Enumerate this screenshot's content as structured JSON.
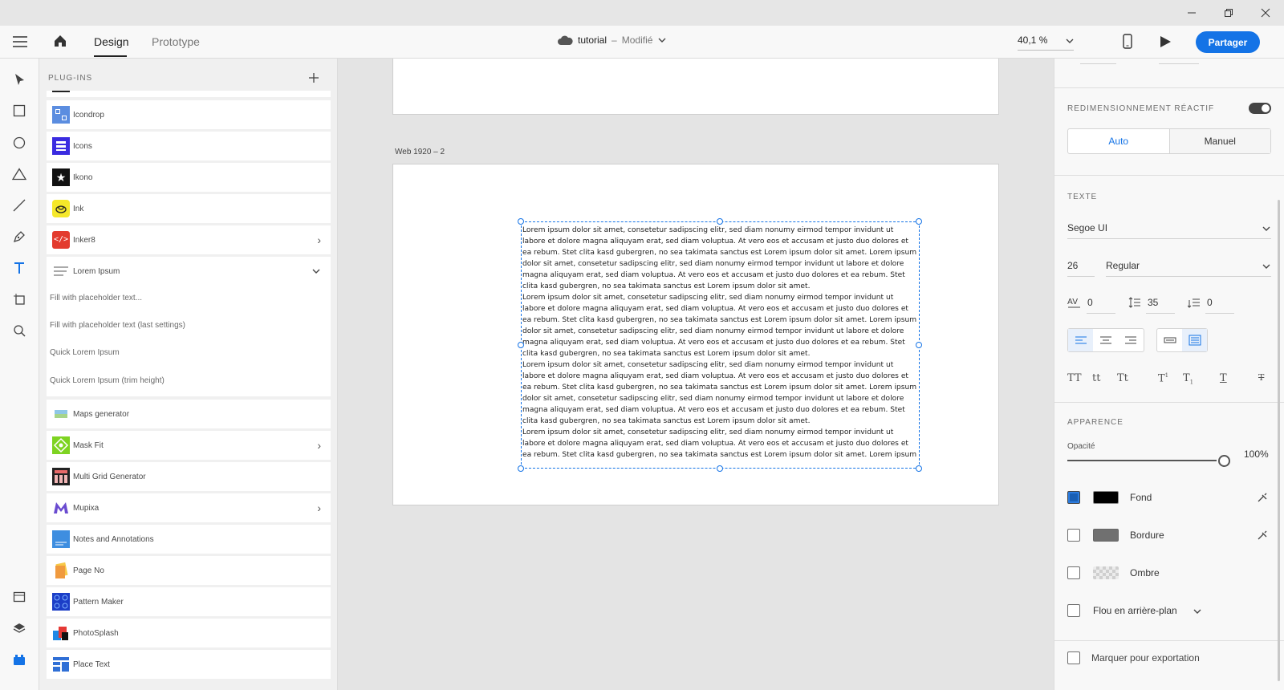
{
  "appbar": {
    "tab_design": "Design",
    "tab_prototype": "Prototype",
    "doc_name": "tutorial",
    "doc_separator": "–",
    "doc_status": "Modifié",
    "zoom": "40,1 %",
    "share_label": "Partager"
  },
  "plugins": {
    "title": "PLUG-INS",
    "items": [
      {
        "label": "Icondrop"
      },
      {
        "label": "Icons"
      },
      {
        "label": "Ikono"
      },
      {
        "label": "Ink"
      },
      {
        "label": "Inker8"
      },
      {
        "label": "Lorem Ipsum"
      },
      {
        "label": "Maps generator"
      },
      {
        "label": "Mask Fit"
      },
      {
        "label": "Multi Grid Generator"
      },
      {
        "label": "Mupixa"
      },
      {
        "label": "Notes and Annotations"
      },
      {
        "label": "Page No"
      },
      {
        "label": "Pattern Maker"
      },
      {
        "label": "PhotoSplash"
      },
      {
        "label": "Place Text"
      }
    ],
    "lorem_sub": [
      "Fill with placeholder text...",
      "Fill with placeholder text (last settings)",
      "Quick Lorem Ipsum",
      "Quick Lorem Ipsum (trim height)"
    ]
  },
  "canvas": {
    "artboard_label": "Web 1920 – 2",
    "lorem_text": "Lorem ipsum dolor sit amet, consetetur sadipscing elitr, sed diam nonumy eirmod tempor invidunt ut\nlabore et dolore magna aliquyam erat, sed diam voluptua. At vero eos et accusam et justo duo dolores et\nea rebum. Stet clita kasd gubergren, no sea takimata sanctus est Lorem ipsum dolor sit amet. Lorem ipsum\ndolor sit amet, consetetur sadipscing elitr, sed diam nonumy eirmod tempor invidunt ut labore et dolore\nmagna aliquyam erat, sed diam voluptua. At vero eos et accusam et justo duo dolores et ea rebum. Stet\nclita kasd gubergren, no sea takimata sanctus est Lorem ipsum dolor sit amet.\nLorem ipsum dolor sit amet, consetetur sadipscing elitr, sed diam nonumy eirmod tempor invidunt ut\nlabore et dolore magna aliquyam erat, sed diam voluptua. At vero eos et accusam et justo duo dolores et\nea rebum. Stet clita kasd gubergren, no sea takimata sanctus est Lorem ipsum dolor sit amet. Lorem ipsum\ndolor sit amet, consetetur sadipscing elitr, sed diam nonumy eirmod tempor invidunt ut labore et dolore\nmagna aliquyam erat, sed diam voluptua. At vero eos et accusam et justo duo dolores et ea rebum. Stet\nclita kasd gubergren, no sea takimata sanctus est Lorem ipsum dolor sit amet.\nLorem ipsum dolor sit amet, consetetur sadipscing elitr, sed diam nonumy eirmod tempor invidunt ut\nlabore et dolore magna aliquyam erat, sed diam voluptua. At vero eos et accusam et justo duo dolores et\nea rebum. Stet clita kasd gubergren, no sea takimata sanctus est Lorem ipsum dolor sit amet. Lorem ipsum\ndolor sit amet, consetetur sadipscing elitr, sed diam nonumy eirmod tempor invidunt ut labore et dolore\nmagna aliquyam erat, sed diam voluptua. At vero eos et accusam et justo duo dolores et ea rebum. Stet\nclita kasd gubergren, no sea takimata sanctus est Lorem ipsum dolor sit amet.\nLorem ipsum dolor sit amet, consetetur sadipscing elitr, sed diam nonumy eirmod tempor invidunt ut\nlabore et dolore magna aliquyam erat, sed diam voluptua. At vero eos et accusam et justo duo dolores et\nea rebum. Stet clita kasd gubergren, no sea takimata sanctus est Lorem ipsum dolor sit amet. Lorem ipsum"
  },
  "properties": {
    "responsive_title": "REDIMENSIONNEMENT RÉACTIF",
    "auto_label": "Auto",
    "manual_label": "Manuel",
    "text_title": "TEXTE",
    "font_family": "Segoe UI",
    "font_size": "26",
    "font_weight": "Regular",
    "char_spacing": "0",
    "line_spacing": "35",
    "para_spacing": "0",
    "appearance_title": "APPARENCE",
    "opacity_label": "Opacité",
    "opacity_value": "100%",
    "fill_label": "Fond",
    "border_label": "Bordure",
    "shadow_label": "Ombre",
    "blur_label": "Flou en arrière-plan",
    "export_label": "Marquer pour exportation"
  },
  "colors": {
    "accent": "#1473e6",
    "fill": "#000000",
    "border": "#707070"
  }
}
